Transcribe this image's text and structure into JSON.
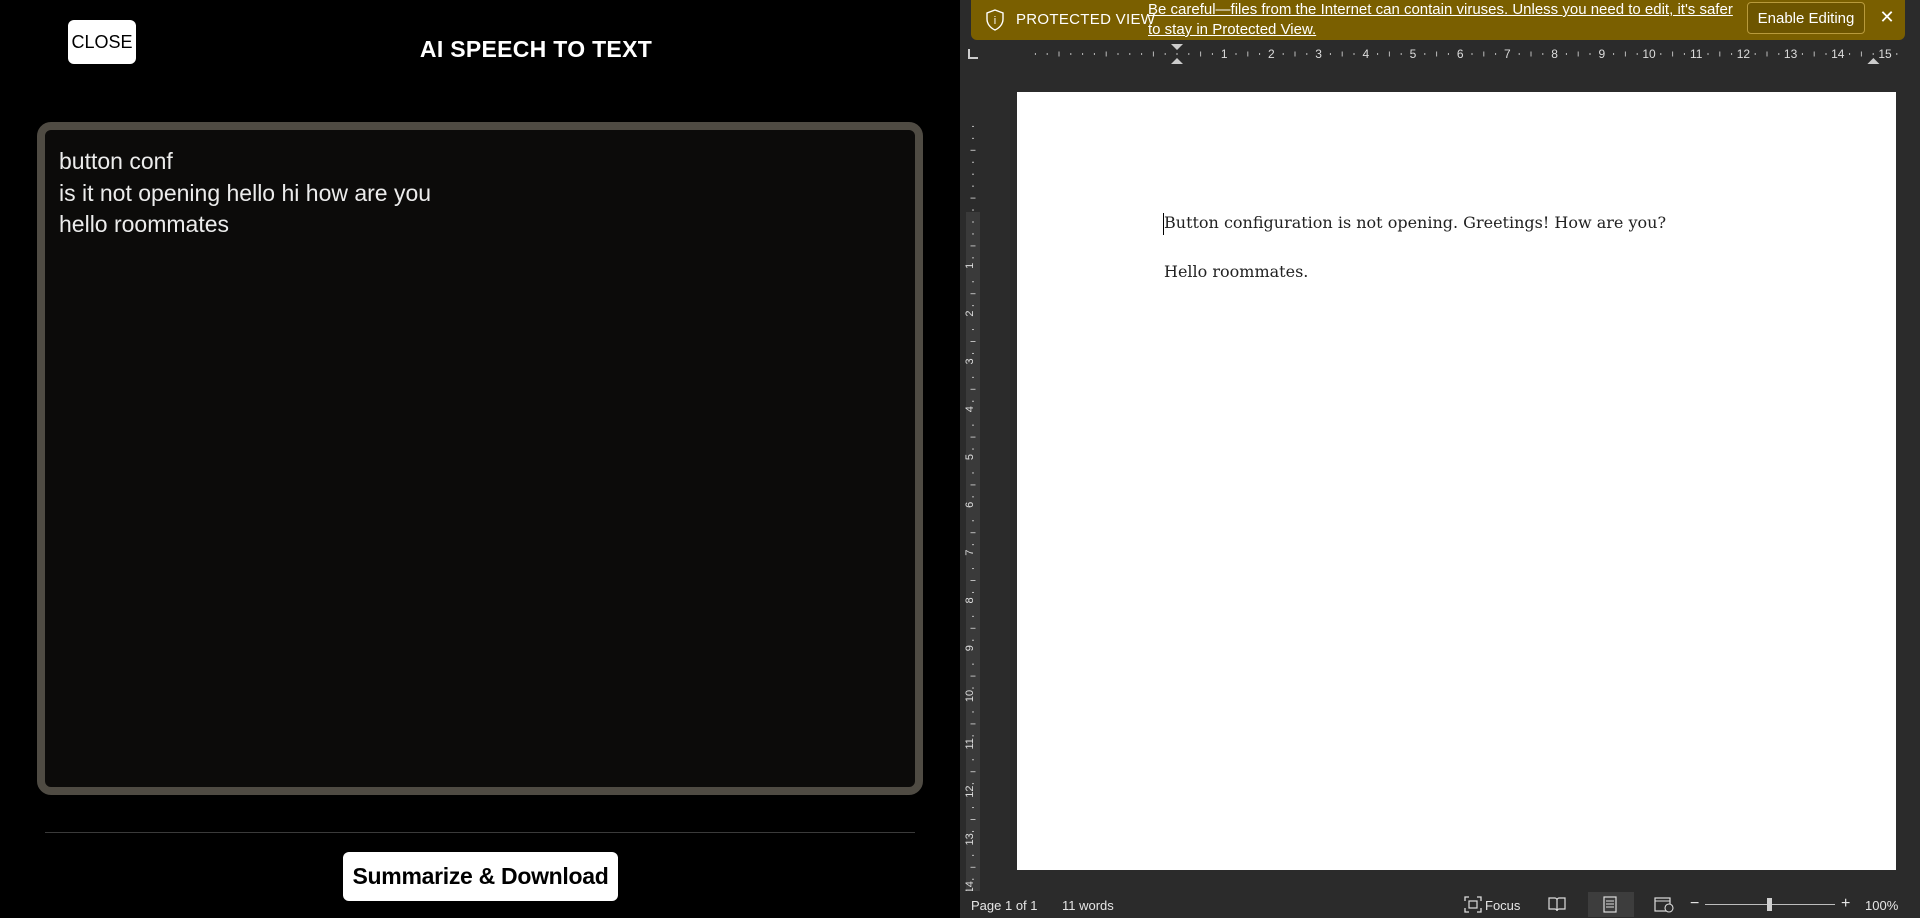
{
  "left_app": {
    "close_label": "CLOSE",
    "title": "AI SPEECH TO TEXT",
    "transcript_lines": [
      "button conf",
      "is it not opening hello hi how are you",
      "hello roommates"
    ],
    "summarize_label": "Summarize & Download"
  },
  "word": {
    "protected_view": {
      "label": "PROTECTED VIEW",
      "message_line1": "Be careful—files from the Internet can contain viruses. Unless you need to edit, it's safer",
      "message_line2": "to stay in Protected View.",
      "enable_label": "Enable Editing",
      "close_glyph": "✕"
    },
    "ruler_numbers": [
      "1",
      "2",
      "3",
      "4",
      "5",
      "6",
      "7",
      "8",
      "9",
      "10",
      "11",
      "12",
      "13",
      "14",
      "15"
    ],
    "vruler_numbers": [
      "1",
      "2",
      "3",
      "4",
      "5",
      "6",
      "7",
      "8",
      "9",
      "10",
      "11",
      "12",
      "13",
      "14"
    ],
    "document_lines": [
      "Button configuration is not opening. Greetings! How are you?",
      "Hello roommates."
    ],
    "status": {
      "page": "Page 1 of 1",
      "words": "11 words",
      "focus": "Focus",
      "zoom_minus": "−",
      "zoom_plus": "+",
      "zoom": "100%"
    }
  },
  "colors": {
    "protected_bar": "#7a5f00",
    "transcript_border": "#4f4b43",
    "word_background": "#2b2b2b"
  }
}
